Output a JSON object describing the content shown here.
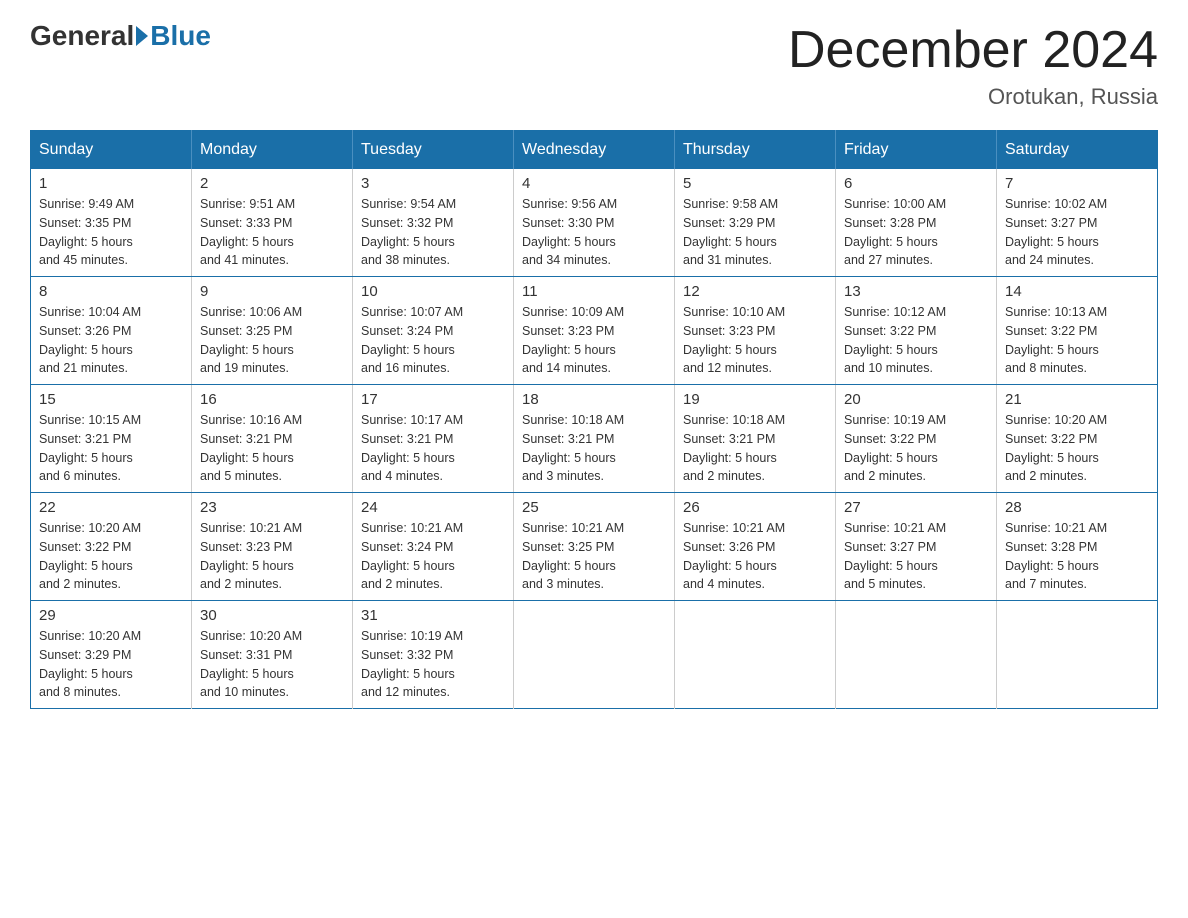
{
  "header": {
    "logo_general": "General",
    "logo_blue": "Blue",
    "month_title": "December 2024",
    "location": "Orotukan, Russia"
  },
  "days_of_week": [
    "Sunday",
    "Monday",
    "Tuesday",
    "Wednesday",
    "Thursday",
    "Friday",
    "Saturday"
  ],
  "weeks": [
    [
      {
        "day": "1",
        "sunrise": "9:49 AM",
        "sunset": "3:35 PM",
        "daylight": "5 hours and 45 minutes."
      },
      {
        "day": "2",
        "sunrise": "9:51 AM",
        "sunset": "3:33 PM",
        "daylight": "5 hours and 41 minutes."
      },
      {
        "day": "3",
        "sunrise": "9:54 AM",
        "sunset": "3:32 PM",
        "daylight": "5 hours and 38 minutes."
      },
      {
        "day": "4",
        "sunrise": "9:56 AM",
        "sunset": "3:30 PM",
        "daylight": "5 hours and 34 minutes."
      },
      {
        "day": "5",
        "sunrise": "9:58 AM",
        "sunset": "3:29 PM",
        "daylight": "5 hours and 31 minutes."
      },
      {
        "day": "6",
        "sunrise": "10:00 AM",
        "sunset": "3:28 PM",
        "daylight": "5 hours and 27 minutes."
      },
      {
        "day": "7",
        "sunrise": "10:02 AM",
        "sunset": "3:27 PM",
        "daylight": "5 hours and 24 minutes."
      }
    ],
    [
      {
        "day": "8",
        "sunrise": "10:04 AM",
        "sunset": "3:26 PM",
        "daylight": "5 hours and 21 minutes."
      },
      {
        "day": "9",
        "sunrise": "10:06 AM",
        "sunset": "3:25 PM",
        "daylight": "5 hours and 19 minutes."
      },
      {
        "day": "10",
        "sunrise": "10:07 AM",
        "sunset": "3:24 PM",
        "daylight": "5 hours and 16 minutes."
      },
      {
        "day": "11",
        "sunrise": "10:09 AM",
        "sunset": "3:23 PM",
        "daylight": "5 hours and 14 minutes."
      },
      {
        "day": "12",
        "sunrise": "10:10 AM",
        "sunset": "3:23 PM",
        "daylight": "5 hours and 12 minutes."
      },
      {
        "day": "13",
        "sunrise": "10:12 AM",
        "sunset": "3:22 PM",
        "daylight": "5 hours and 10 minutes."
      },
      {
        "day": "14",
        "sunrise": "10:13 AM",
        "sunset": "3:22 PM",
        "daylight": "5 hours and 8 minutes."
      }
    ],
    [
      {
        "day": "15",
        "sunrise": "10:15 AM",
        "sunset": "3:21 PM",
        "daylight": "5 hours and 6 minutes."
      },
      {
        "day": "16",
        "sunrise": "10:16 AM",
        "sunset": "3:21 PM",
        "daylight": "5 hours and 5 minutes."
      },
      {
        "day": "17",
        "sunrise": "10:17 AM",
        "sunset": "3:21 PM",
        "daylight": "5 hours and 4 minutes."
      },
      {
        "day": "18",
        "sunrise": "10:18 AM",
        "sunset": "3:21 PM",
        "daylight": "5 hours and 3 minutes."
      },
      {
        "day": "19",
        "sunrise": "10:18 AM",
        "sunset": "3:21 PM",
        "daylight": "5 hours and 2 minutes."
      },
      {
        "day": "20",
        "sunrise": "10:19 AM",
        "sunset": "3:22 PM",
        "daylight": "5 hours and 2 minutes."
      },
      {
        "day": "21",
        "sunrise": "10:20 AM",
        "sunset": "3:22 PM",
        "daylight": "5 hours and 2 minutes."
      }
    ],
    [
      {
        "day": "22",
        "sunrise": "10:20 AM",
        "sunset": "3:22 PM",
        "daylight": "5 hours and 2 minutes."
      },
      {
        "day": "23",
        "sunrise": "10:21 AM",
        "sunset": "3:23 PM",
        "daylight": "5 hours and 2 minutes."
      },
      {
        "day": "24",
        "sunrise": "10:21 AM",
        "sunset": "3:24 PM",
        "daylight": "5 hours and 2 minutes."
      },
      {
        "day": "25",
        "sunrise": "10:21 AM",
        "sunset": "3:25 PM",
        "daylight": "5 hours and 3 minutes."
      },
      {
        "day": "26",
        "sunrise": "10:21 AM",
        "sunset": "3:26 PM",
        "daylight": "5 hours and 4 minutes."
      },
      {
        "day": "27",
        "sunrise": "10:21 AM",
        "sunset": "3:27 PM",
        "daylight": "5 hours and 5 minutes."
      },
      {
        "day": "28",
        "sunrise": "10:21 AM",
        "sunset": "3:28 PM",
        "daylight": "5 hours and 7 minutes."
      }
    ],
    [
      {
        "day": "29",
        "sunrise": "10:20 AM",
        "sunset": "3:29 PM",
        "daylight": "5 hours and 8 minutes."
      },
      {
        "day": "30",
        "sunrise": "10:20 AM",
        "sunset": "3:31 PM",
        "daylight": "5 hours and 10 minutes."
      },
      {
        "day": "31",
        "sunrise": "10:19 AM",
        "sunset": "3:32 PM",
        "daylight": "5 hours and 12 minutes."
      },
      null,
      null,
      null,
      null
    ]
  ],
  "labels": {
    "sunrise": "Sunrise:",
    "sunset": "Sunset:",
    "daylight": "Daylight:"
  }
}
